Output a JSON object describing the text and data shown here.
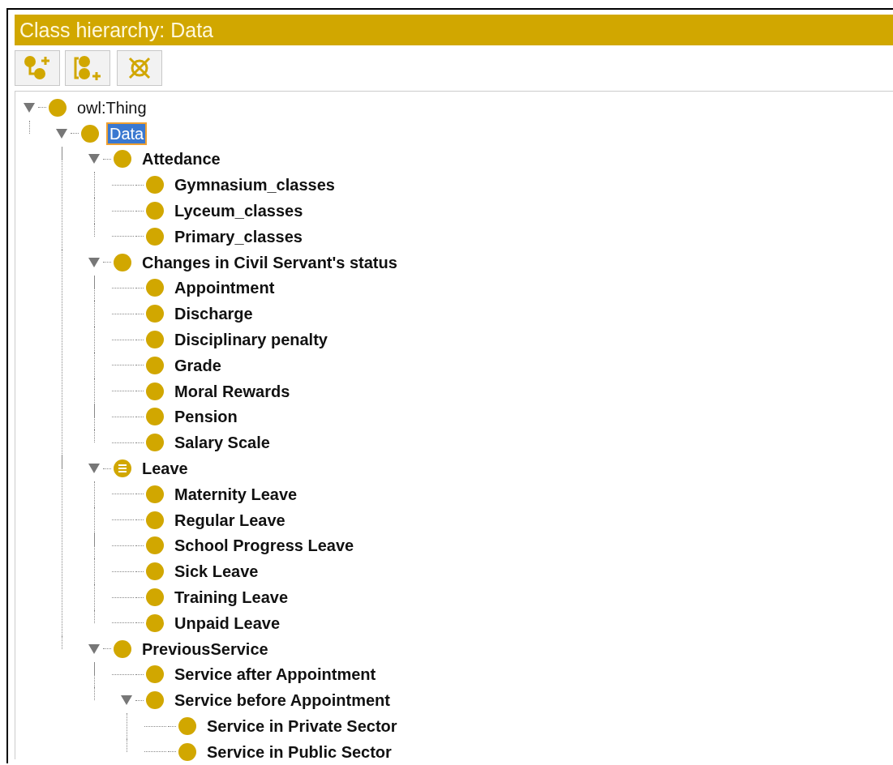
{
  "panel": {
    "title": "Class hierarchy: Data"
  },
  "toolbar": [
    {
      "kind": "add_subclass"
    },
    {
      "kind": "add_sibling"
    },
    {
      "kind": "delete"
    }
  ],
  "tree": [
    {
      "label": "owl:Thing",
      "kind": "class",
      "bold": false,
      "selected": false,
      "expanded": true,
      "children": [
        {
          "label": "Data",
          "kind": "class",
          "bold": false,
          "selected": true,
          "expanded": true,
          "children": [
            {
              "label": "Attedance",
              "kind": "class",
              "bold": true,
              "selected": false,
              "expanded": true,
              "children": [
                {
                  "label": "Gymnasium_classes",
                  "kind": "class",
                  "bold": true,
                  "selected": false
                },
                {
                  "label": "Lyceum_classes",
                  "kind": "class",
                  "bold": true,
                  "selected": false
                },
                {
                  "label": "Primary_classes",
                  "kind": "class",
                  "bold": true,
                  "selected": false
                }
              ]
            },
            {
              "label": "Changes in Civil Servant's status",
              "kind": "class",
              "bold": true,
              "selected": false,
              "expanded": true,
              "children": [
                {
                  "label": "Appointment",
                  "kind": "class",
                  "bold": true,
                  "selected": false
                },
                {
                  "label": "Discharge",
                  "kind": "class",
                  "bold": true,
                  "selected": false
                },
                {
                  "label": "Disciplinary penalty",
                  "kind": "class",
                  "bold": true,
                  "selected": false
                },
                {
                  "label": "Grade",
                  "kind": "class",
                  "bold": true,
                  "selected": false
                },
                {
                  "label": "Moral Rewards",
                  "kind": "class",
                  "bold": true,
                  "selected": false
                },
                {
                  "label": "Pension",
                  "kind": "class",
                  "bold": true,
                  "selected": false
                },
                {
                  "label": "Salary Scale",
                  "kind": "class",
                  "bold": true,
                  "selected": false
                }
              ]
            },
            {
              "label": "Leave",
              "kind": "defined",
              "bold": true,
              "selected": false,
              "expanded": true,
              "children": [
                {
                  "label": "Maternity Leave",
                  "kind": "class",
                  "bold": true,
                  "selected": false
                },
                {
                  "label": "Regular Leave",
                  "kind": "class",
                  "bold": true,
                  "selected": false
                },
                {
                  "label": "School Progress Leave",
                  "kind": "class",
                  "bold": true,
                  "selected": false
                },
                {
                  "label": "Sick Leave",
                  "kind": "class",
                  "bold": true,
                  "selected": false
                },
                {
                  "label": "Training Leave",
                  "kind": "class",
                  "bold": true,
                  "selected": false
                },
                {
                  "label": "Unpaid Leave",
                  "kind": "class",
                  "bold": true,
                  "selected": false
                }
              ]
            },
            {
              "label": "PreviousService",
              "kind": "class",
              "bold": true,
              "selected": false,
              "expanded": true,
              "children": [
                {
                  "label": "Service after Appointment",
                  "kind": "class",
                  "bold": true,
                  "selected": false
                },
                {
                  "label": "Service before Appointment",
                  "kind": "class",
                  "bold": true,
                  "selected": false,
                  "expanded": true,
                  "children": [
                    {
                      "label": "Service in Private Sector",
                      "kind": "class",
                      "bold": true,
                      "selected": false
                    },
                    {
                      "label": "Service in Public Sector",
                      "kind": "class",
                      "bold": true,
                      "selected": false
                    }
                  ]
                }
              ]
            }
          ]
        }
      ]
    }
  ]
}
